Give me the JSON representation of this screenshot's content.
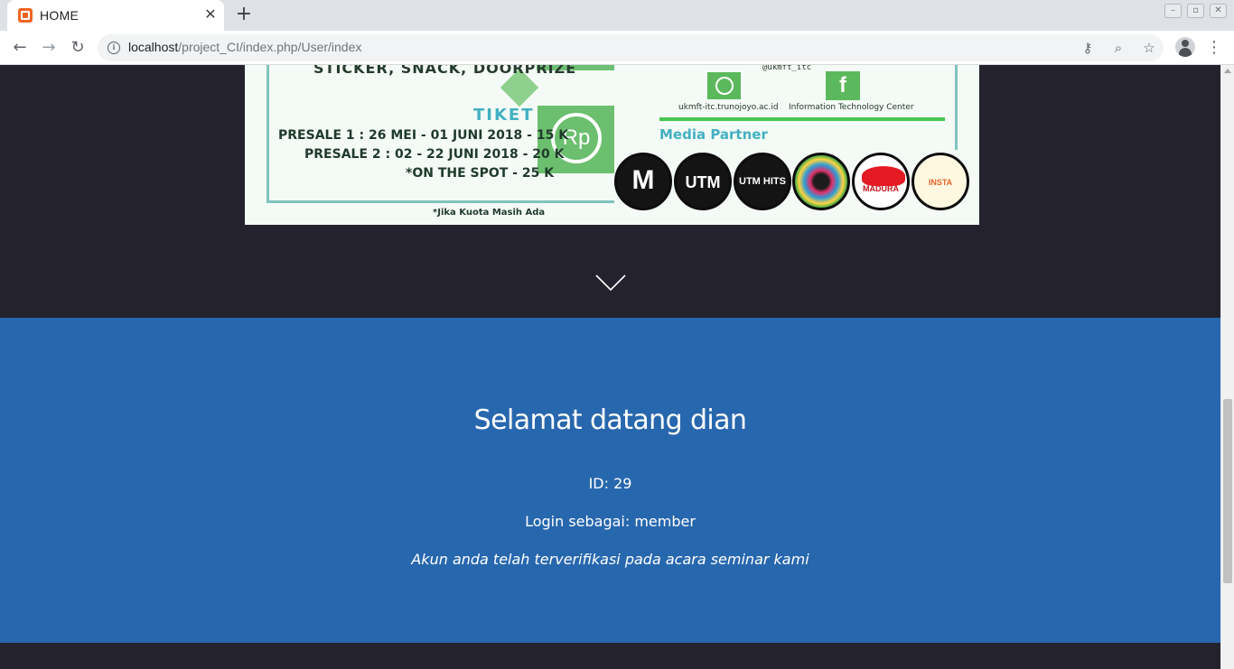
{
  "browser": {
    "tab_title": "HOME",
    "tab_close": "✕",
    "new_tab": "+",
    "window_controls": [
      "–",
      "▫",
      "✕"
    ],
    "url_host": "localhost",
    "url_path": "/project_CI/index.php/User/index",
    "icons": [
      "back-arrow-icon",
      "forward-arrow-icon",
      "reload-icon",
      "info-icon",
      "key-icon",
      "zoom-icon",
      "star-icon",
      "profile-avatar-icon",
      "menu-dots-icon"
    ]
  },
  "poster": {
    "top_line": "STICKER, SNACK, DOORPRIZE",
    "handle": "@ukmft_itc",
    "website": "ukmft-itc.trunojoyo.ac.id",
    "facebook": "Information Technology Center",
    "fb_glyph": "f",
    "tiket": "TIKET",
    "rp": "Rp",
    "presale1": "PRESALE 1 : 26 MEI - 01 JUNI 2018 - 15 K",
    "presale2": "PRESALE 2 : 02 - 22 JUNI 2018 - 20 K",
    "on_the_spot": "*ON THE SPOT - 25 K",
    "kuota": "*Jika Kuota Masih Ada",
    "media_partner": "Media Partner",
    "partners": [
      "M",
      "UTM",
      "UTM HITS",
      "",
      "MADURA HOLIC",
      "INSTA"
    ]
  },
  "welcome": {
    "title": "Selamat datang dian",
    "id_line": "ID: 29",
    "role_line": "Login sebagai: member",
    "note": "Akun anda telah terverifikasi pada acara seminar kami",
    "background": "#2767ae"
  },
  "colors": {
    "hero_bg": "#24232d",
    "accent_blue": "#2767ae"
  }
}
